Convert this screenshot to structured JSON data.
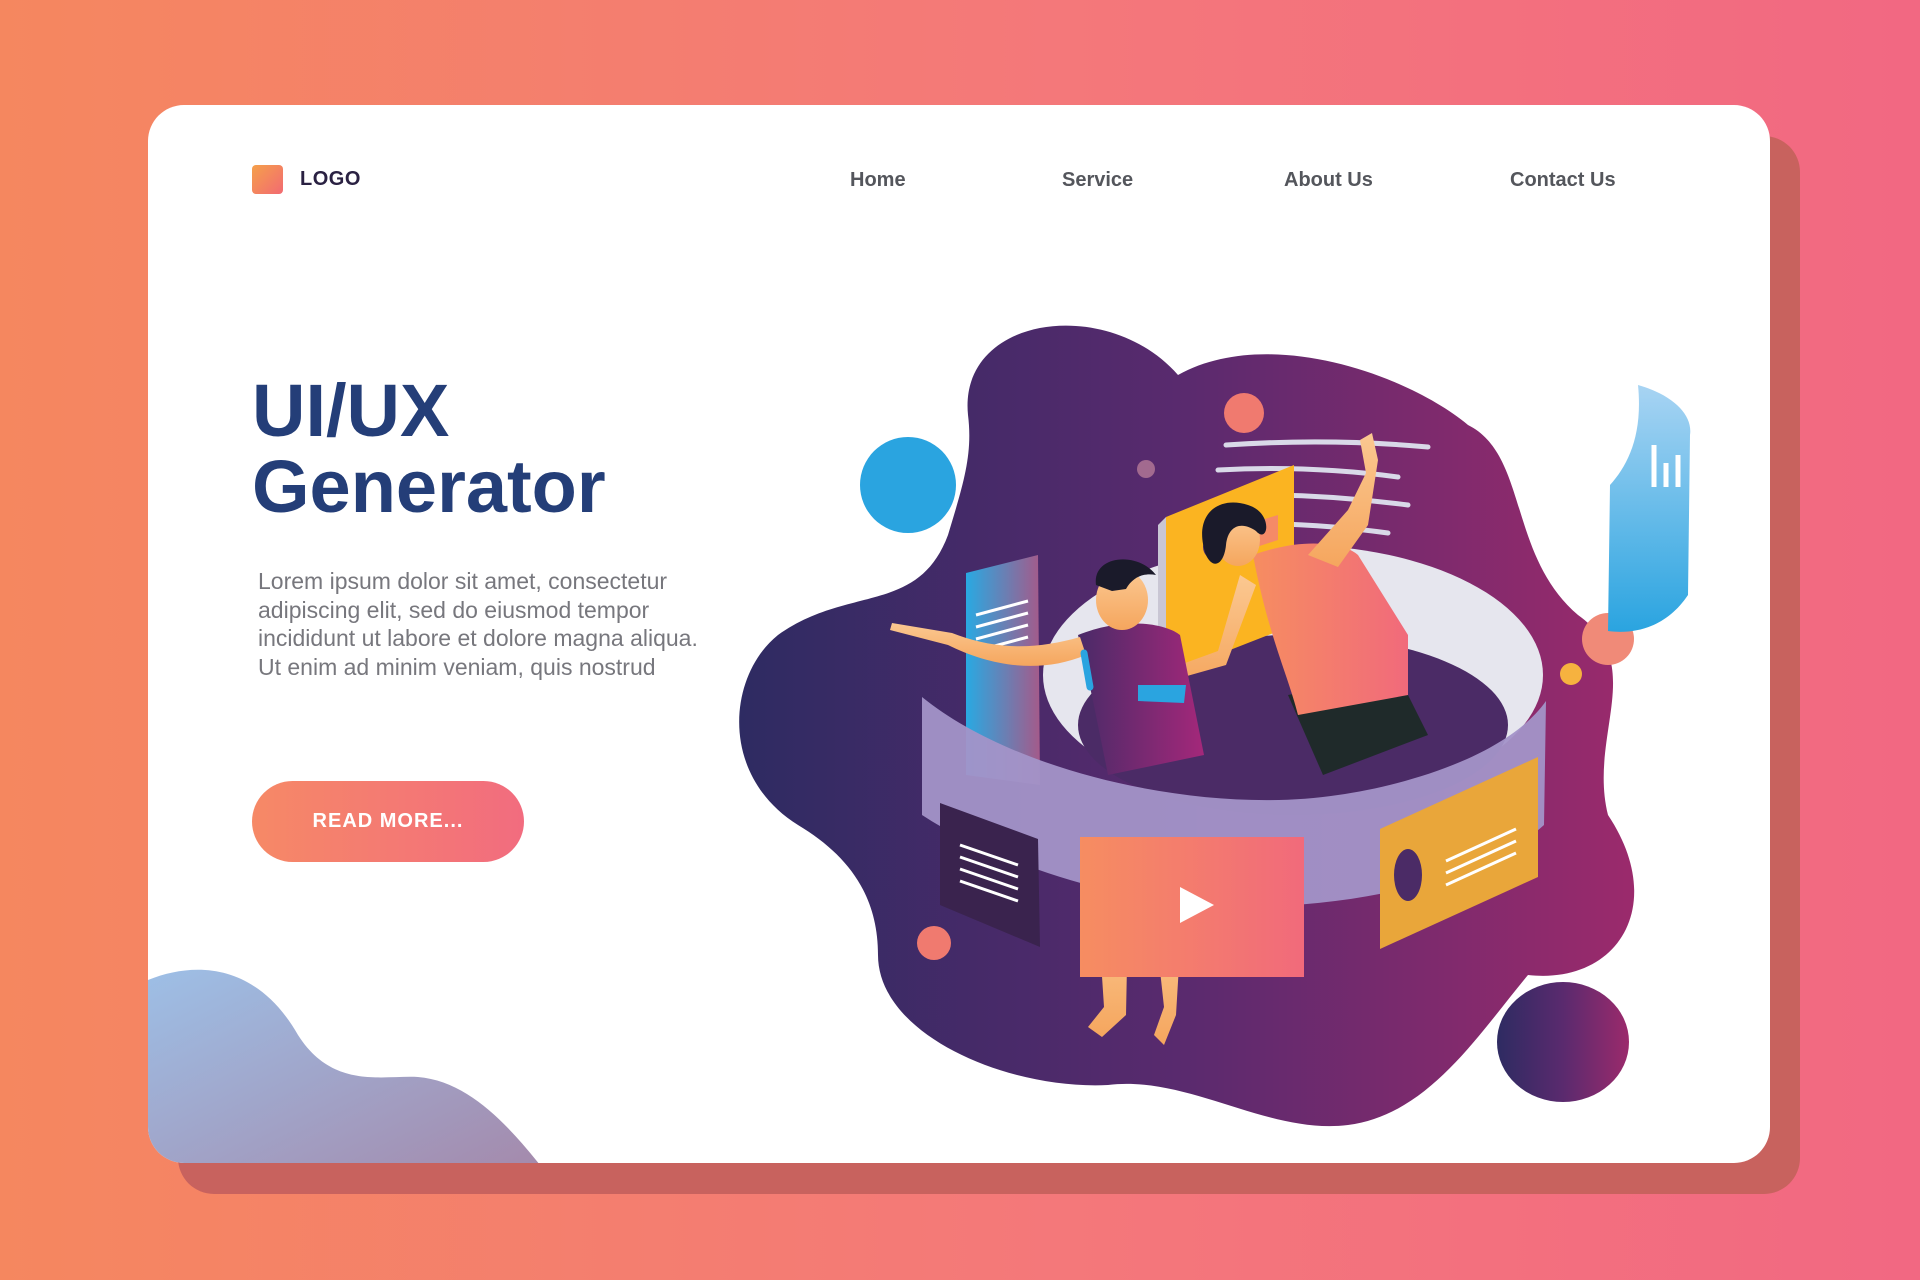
{
  "header": {
    "logo": "LOGO",
    "nav": [
      "Home",
      "Service",
      "About Us",
      "Contact Us"
    ]
  },
  "hero": {
    "title_line1": "UI/UX",
    "title_line2": "Generator",
    "description": "Lorem ipsum dolor sit amet, consectetur adipiscing elit, sed do eiusmod tempor incididunt ut labore et dolore magna aliqua. Ut enim ad minim veniam, quis nostrud",
    "cta_label": "READ MORE..."
  },
  "colors": {
    "background_start": "#f5875f",
    "background_end": "#f26882",
    "title": "#243e78",
    "cta_start": "#f68966",
    "cta_end": "#f26c7f",
    "blob_start": "#2e2b62",
    "blob_end": "#9b2a6c"
  },
  "icons": [
    "logo-mark",
    "play-icon"
  ]
}
